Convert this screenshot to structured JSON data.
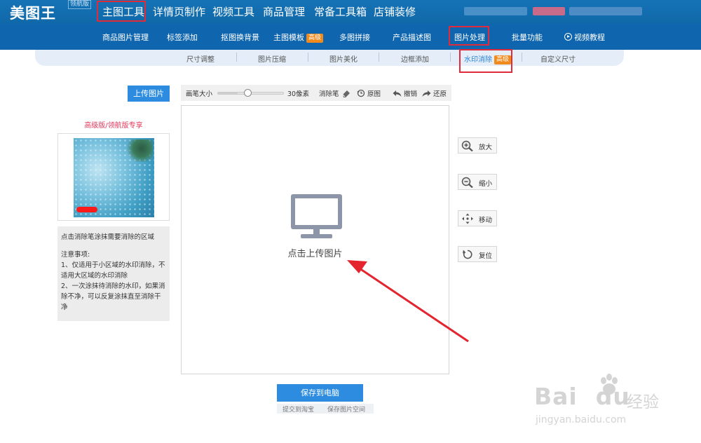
{
  "brand": {
    "logo": "美图王",
    "edition": "领航版"
  },
  "top_nav": [
    "主图工具",
    "详情页制作",
    "视频工具",
    "商品管理",
    "常备工具箱",
    "店铺装修"
  ],
  "second_nav": {
    "items": [
      "商品图片管理",
      "标签添加",
      "抠图换背景",
      "主图模板",
      "多图拼接",
      "产品描述图",
      "图片处理",
      "批量功能",
      "视频教程"
    ],
    "badge": "高级"
  },
  "sub_nav": {
    "items": [
      "尺寸调整",
      "图片压缩",
      "图片美化",
      "边框添加",
      "水印消除",
      "自定义尺寸"
    ],
    "badge": "高级"
  },
  "left_panel": {
    "upload_button": "上传图片",
    "pro_label": "高级版/领航版专享",
    "instruction": "点击消除笔涂抹需要消除的区域",
    "notes_title": "注意事项:",
    "notes": [
      "1、仅适用于小区域的水印消除，不适用大区域的水印消除",
      "2、一次涂抹待消除的水印，如果消除不净，可以反复涂抹直至消除干净"
    ]
  },
  "toolbar": {
    "brush_size_label": "画笔大小",
    "brush_value": "30像素",
    "brush_level": 0.3,
    "eraser_label": "消除笔",
    "original_label": "原图",
    "undo_label": "撤销",
    "redo_label": "还原"
  },
  "canvas": {
    "upload_prompt": "点击上传图片"
  },
  "right_buttons": {
    "zoom_in": "放大",
    "zoom_out": "缩小",
    "move": "移动",
    "reset": "复位"
  },
  "bottom": {
    "save_button": "保存到电脑",
    "link_taobao": "提交到淘宝",
    "link_space": "保存图片空间"
  },
  "watermark": {
    "brand": "Bai",
    "brand2": "du",
    "cn": "经验",
    "url": "jingyan.baidu.com"
  },
  "colors": {
    "accent": "#2d8ce0",
    "nav": "#1066ae",
    "highlight_box": "#e02b3a",
    "badge": "#f08a1d",
    "pro": "#e8355a"
  }
}
